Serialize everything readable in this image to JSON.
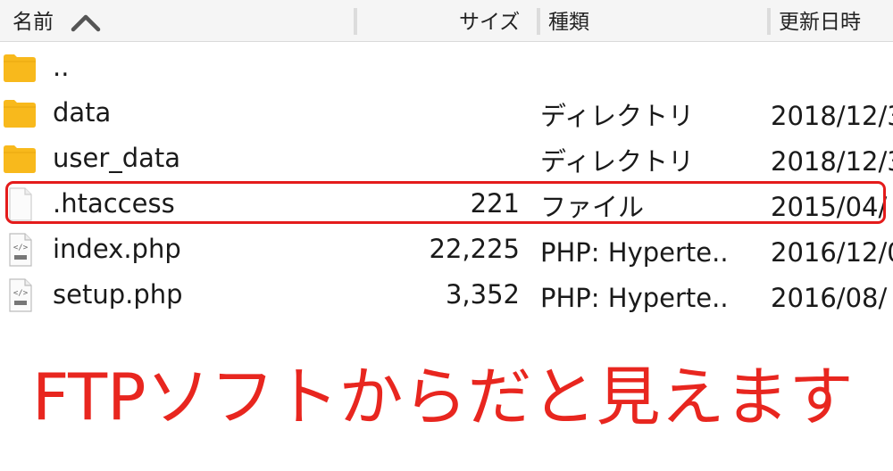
{
  "header": {
    "name": "名前",
    "size": "サイズ",
    "kind": "種類",
    "modified": "更新日時",
    "sort": "ascending"
  },
  "files": [
    {
      "icon": "folder-icon",
      "name": "..",
      "size": "",
      "kind": "",
      "modified": ""
    },
    {
      "icon": "folder-icon",
      "name": "data",
      "size": "",
      "kind": "ディレクトリ",
      "modified": "2018/12/3"
    },
    {
      "icon": "folder-icon",
      "name": "user_data",
      "size": "",
      "kind": "ディレクトリ",
      "modified": "2018/12/3"
    },
    {
      "icon": "blank-file-icon",
      "name": ".htaccess",
      "size": "221",
      "kind": "ファイル",
      "modified": "2015/04/"
    },
    {
      "icon": "php-file-icon",
      "name": "index.php",
      "size": "22,225",
      "kind": "PHP: Hyperte..",
      "modified": "2016/12/0"
    },
    {
      "icon": "php-file-icon",
      "name": "setup.php",
      "size": "3,352",
      "kind": "PHP: Hyperte..",
      "modified": "2016/08/"
    }
  ],
  "highlighted_file": ".htaccess",
  "caption": "FTPソフトからだと見えます",
  "colors": {
    "folder": "#f8b91c",
    "highlight": "#e41b1b",
    "caption": "#e8261f",
    "header_bg": "#f5f5f5"
  }
}
